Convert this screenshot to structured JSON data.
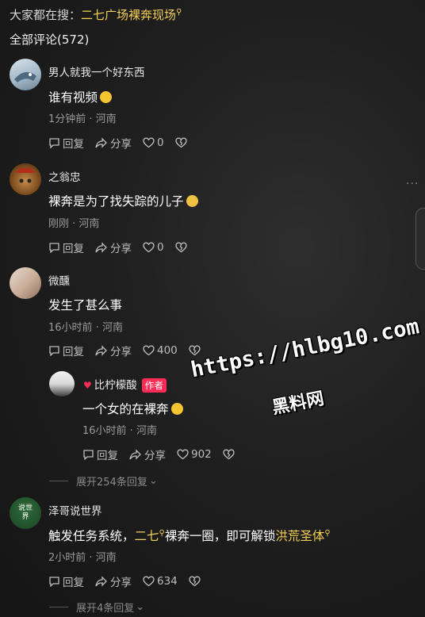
{
  "search": {
    "prefix": "大家都在搜：",
    "term": "二七广场裸奔现场"
  },
  "comment_count": "全部评论(572)",
  "labels": {
    "reply": "回复",
    "share": "分享",
    "author_tag": "作者"
  },
  "comments": [
    {
      "name": "男人就我一个好东西",
      "text": "谁有视频",
      "meta": "1分钟前 · 河南",
      "likes": "0"
    },
    {
      "name": "之翁忠",
      "text": "裸奔是为了找失踪的儿子",
      "meta": "刚刚 · 河南",
      "likes": "0"
    },
    {
      "name": "微醺",
      "text": "发生了甚么事",
      "meta": "16小时前 · 河南",
      "likes": "400"
    },
    {
      "name": "比柠檬酸",
      "text": "一个女的在裸奔",
      "meta": "16小时前 · 河南",
      "likes": "902"
    },
    {
      "name": "泽哥说世界",
      "text_a": "触发任务系统，",
      "text_hl1": "二七",
      "text_b": "裸奔一圈，即可解锁",
      "text_hl2": "洪荒圣体",
      "meta": "2小时前 · 河南",
      "likes": "634",
      "avatar_text": "说世界"
    }
  ],
  "expand": {
    "first": "展开254条回复",
    "second": "展开4条回复"
  },
  "watermark": {
    "url": "https://hlbg10.com",
    "site": "黑料网"
  }
}
